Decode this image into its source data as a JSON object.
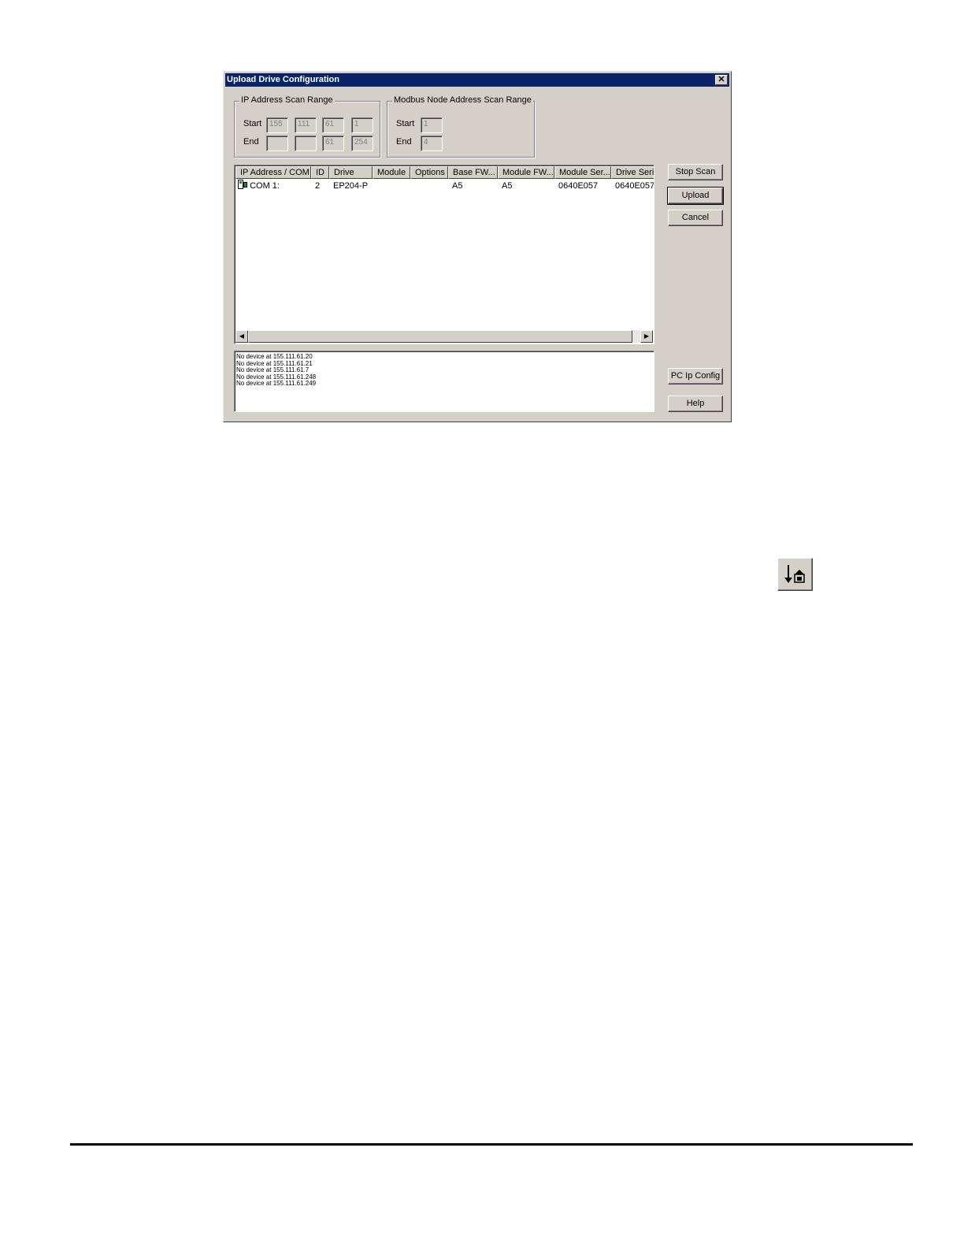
{
  "dialog": {
    "title": "Upload Drive Configuration",
    "close_glyph": "✕"
  },
  "ip_range": {
    "title": "IP Address Scan Range",
    "start_label": "Start",
    "end_label": "End",
    "start": [
      "155",
      "111",
      "61",
      "1"
    ],
    "end": [
      "",
      "",
      "61",
      "254"
    ]
  },
  "modbus_range": {
    "title": "Modbus Node Address Scan Range",
    "start_label": "Start",
    "end_label": "End",
    "start": "1",
    "end": "4"
  },
  "device_list": {
    "columns": [
      "IP Address / COM",
      "ID",
      "Drive",
      "Module",
      "Options",
      "Base FW...",
      "Module FW...",
      "Module Ser...",
      "Drive Seria"
    ],
    "rows": [
      {
        "icon": "drive-icon",
        "cells": [
          "COM 1:",
          "2",
          "EP204-P",
          "",
          "",
          "A5",
          "A5",
          "0640E057",
          "0640E057"
        ]
      }
    ]
  },
  "log": {
    "lines": [
      "No device at 155.111.61.20",
      "No device at 155.111.61.21",
      "No device at 155.111.61.7",
      "No device at 155.111.61.248",
      "No device at 155.111.61.249"
    ]
  },
  "buttons": {
    "stop_scan": "Stop Scan",
    "upload": "Upload",
    "cancel": "Cancel",
    "pc_ip_config": "PC Ip Config",
    "help": "Help"
  },
  "toolbar_icon": {
    "icon": "upload-drive-icon"
  }
}
